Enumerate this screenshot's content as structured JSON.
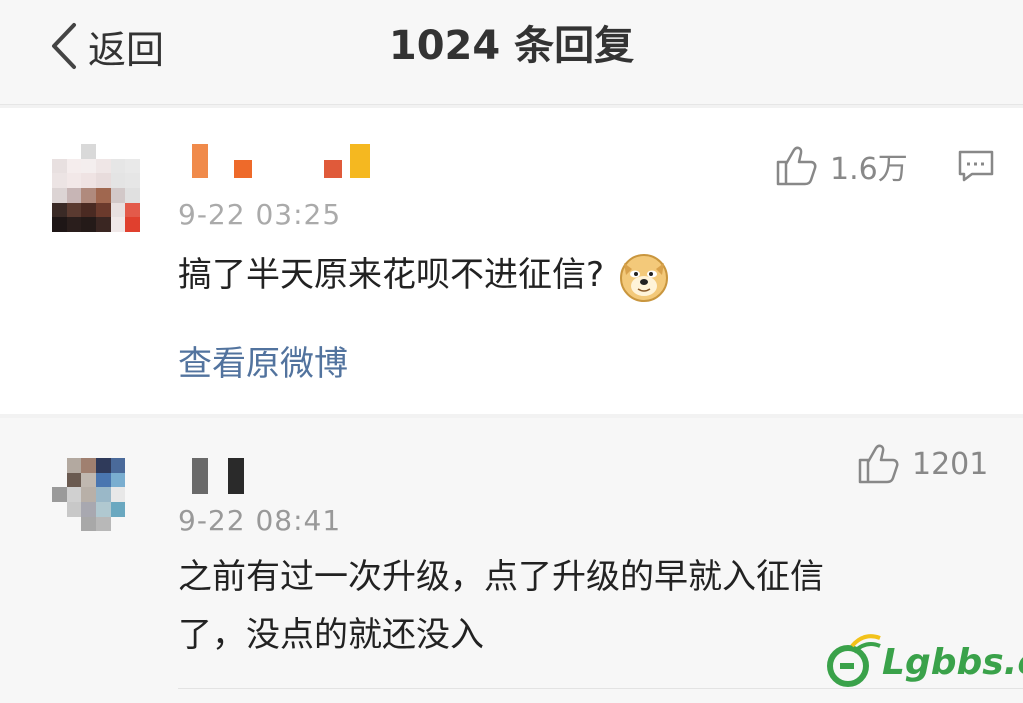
{
  "nav": {
    "back_label": "返回",
    "title": "1024 条回复"
  },
  "comments": [
    {
      "date": "9-22 03:25",
      "text": "搞了半天原来花呗不进征信?",
      "likes": "1.6万",
      "view_original": "查看原微博"
    },
    {
      "date": "9-22 08:41",
      "text_line1": "之前有过一次升级，点了升级的早就入征信",
      "text_line2": "了，没点的就还没入",
      "likes": "1201"
    }
  ],
  "watermark": {
    "text": "Lgbbs.cn"
  },
  "colors": {
    "link": "#52739e",
    "watermark": "#3aa24a"
  }
}
